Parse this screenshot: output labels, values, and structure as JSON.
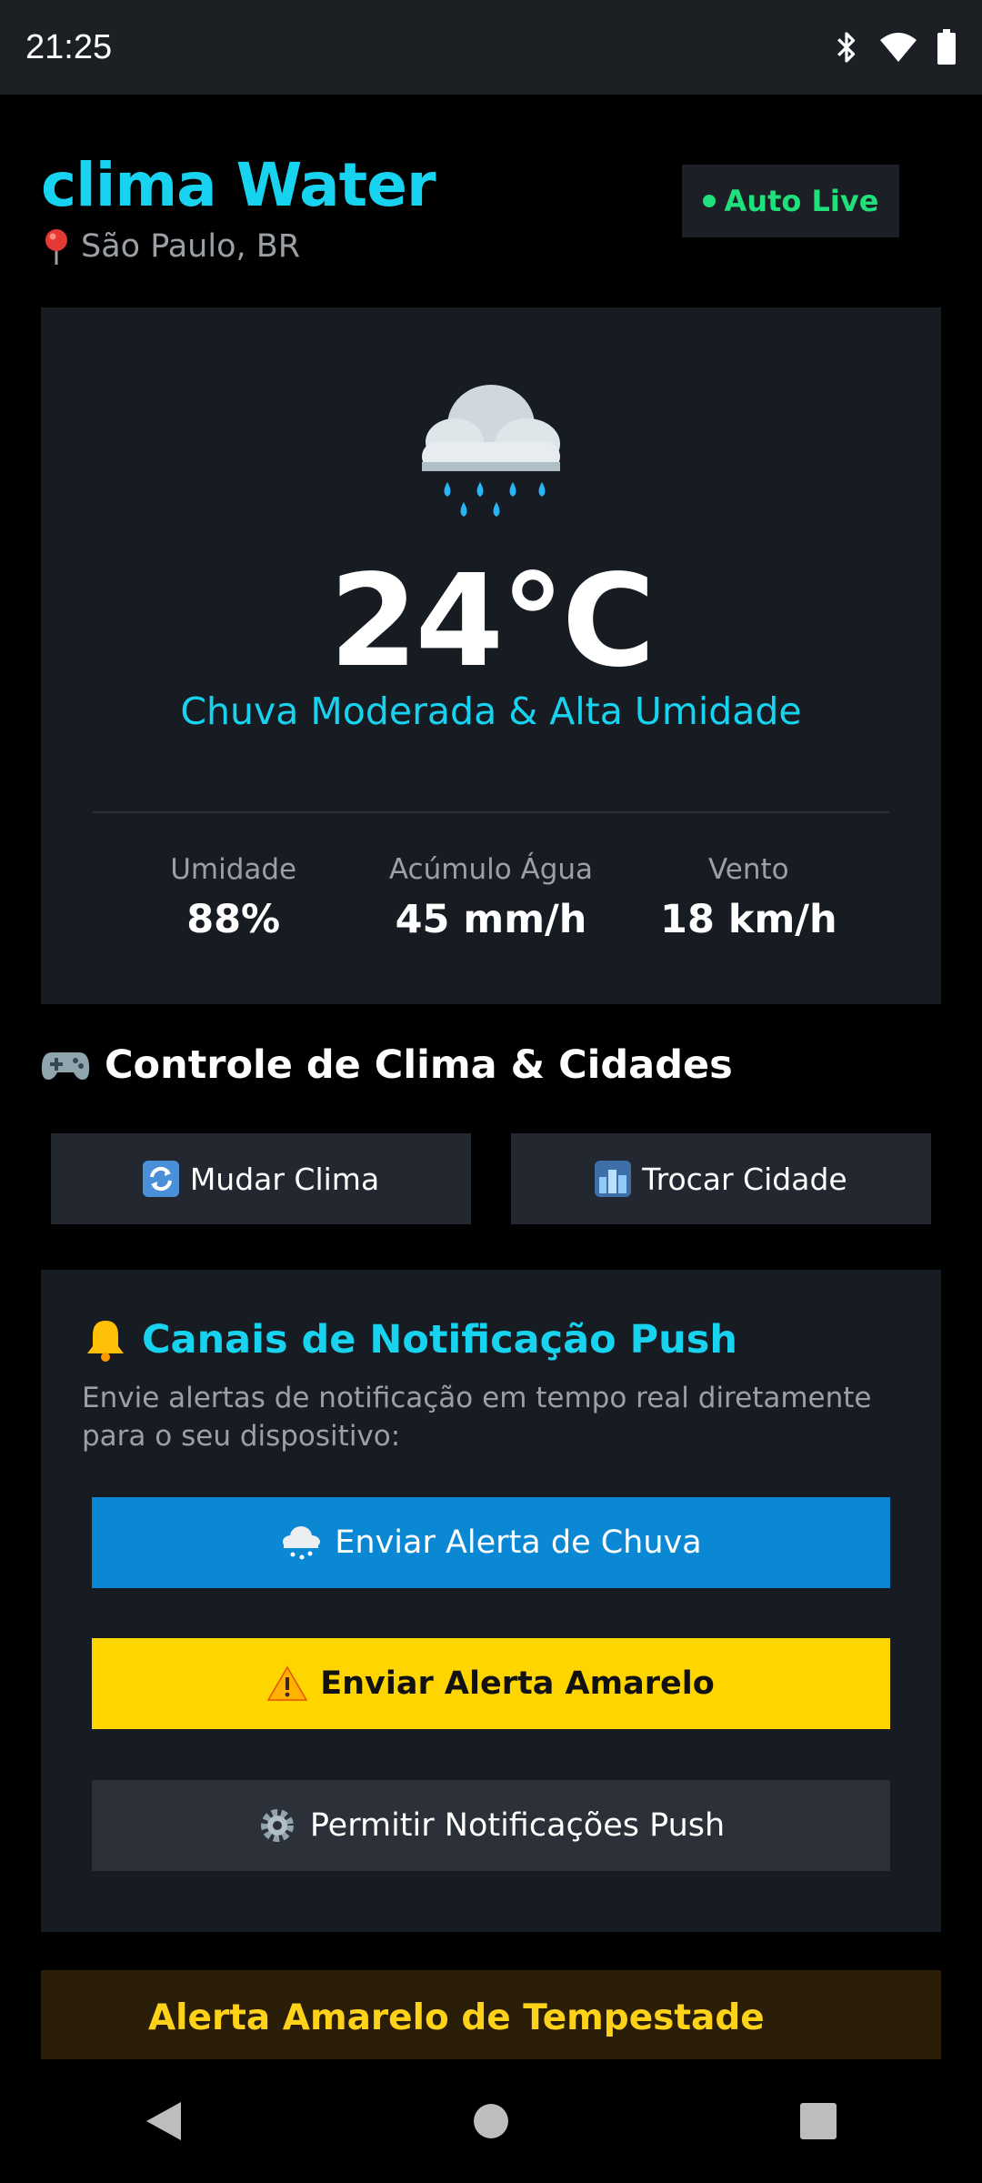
{
  "status_bar": {
    "time": "21:25"
  },
  "header": {
    "title": "clima Water",
    "location": "São Paulo, BR",
    "live_badge": "Auto Live"
  },
  "weather": {
    "temperature": "24°C",
    "condition": "Chuva Moderada & Alta Umidade",
    "stats": [
      {
        "label": "Umidade",
        "value": "88%"
      },
      {
        "label": "Acúmulo Água",
        "value": "45 mm/h"
      },
      {
        "label": "Vento",
        "value": "18 km/h"
      }
    ]
  },
  "controls": {
    "title": "Controle de Clima & Cidades",
    "change_weather_label": "Mudar Clima",
    "change_city_label": "Trocar Cidade"
  },
  "notifications": {
    "title": "Canais de Notificação Push",
    "description": "Envie alertas de notificação em tempo real diretamente para o seu dispositivo:",
    "rain_alert_label": "Enviar Alerta de Chuva",
    "yellow_alert_label": "Enviar Alerta Amarelo",
    "allow_push_label": "Permitir Notificações Push"
  },
  "alert": {
    "title": "Alerta Amarelo de Tempestade"
  },
  "colors": {
    "accent": "#18d3f0",
    "live": "#1fe07a",
    "rain_button": "#0a88d4",
    "yellow_button": "#ffd500",
    "card": "#171b22"
  }
}
